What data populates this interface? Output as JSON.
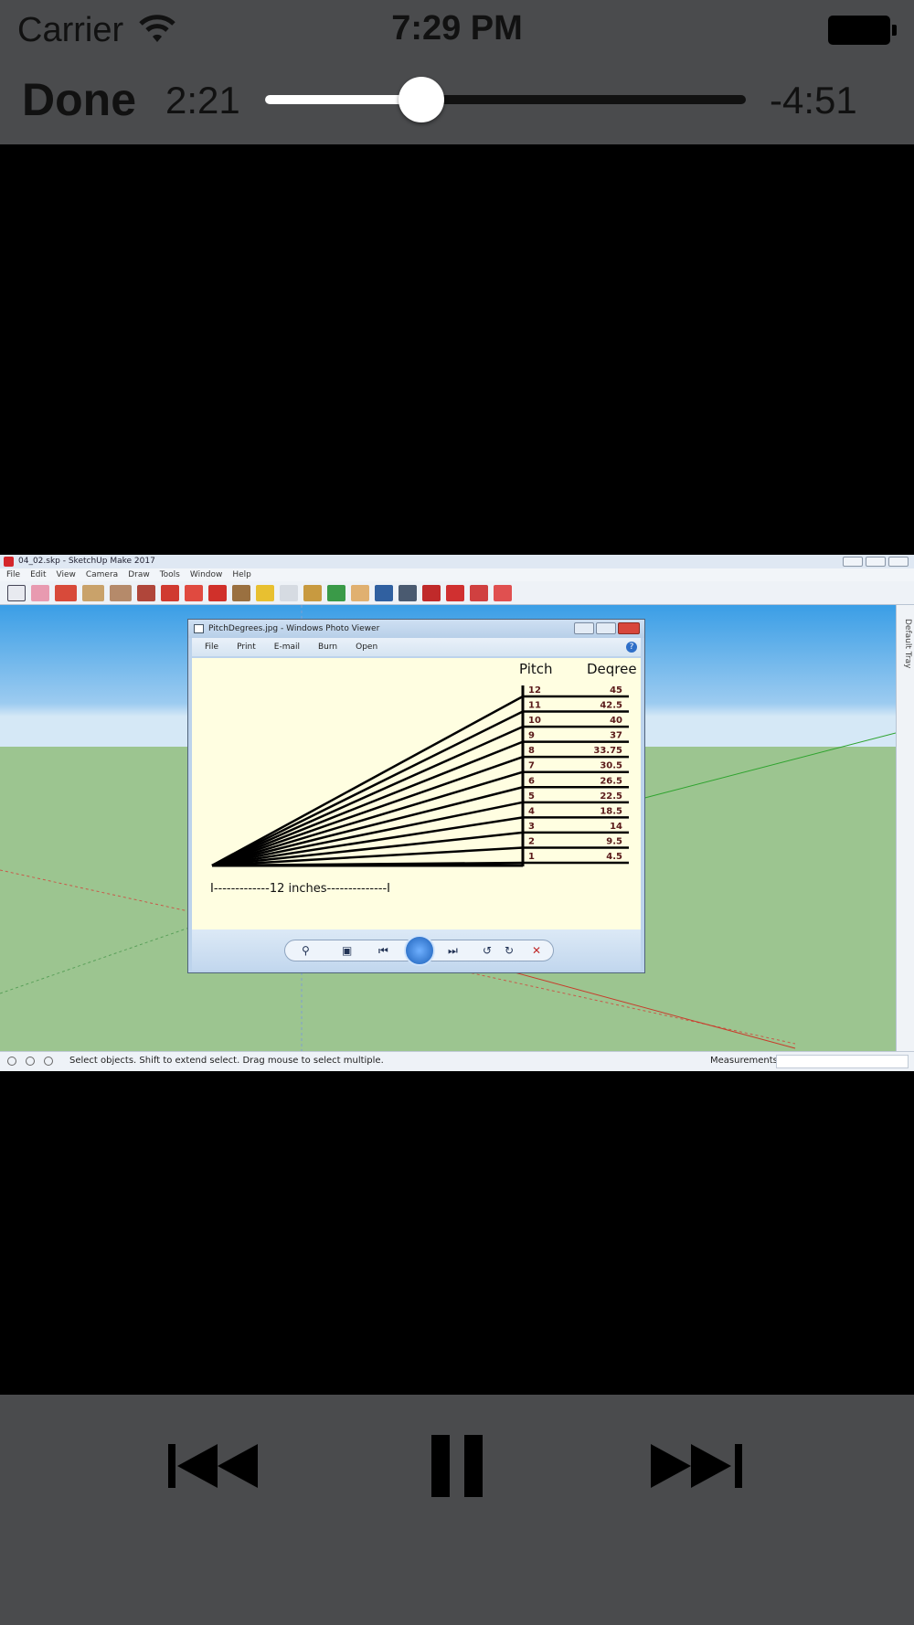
{
  "status_bar": {
    "carrier": "Carrier",
    "time": "7:29 PM",
    "wifi_icon": "wifi-icon",
    "battery_icon": "battery-icon"
  },
  "player": {
    "done_label": "Done",
    "elapsed": "2:21",
    "remaining": "-4:51",
    "progress_fraction": 0.325
  },
  "video_frame": {
    "sketchup": {
      "title": "04_02.skp - SketchUp Make 2017",
      "menu": [
        "File",
        "Edit",
        "View",
        "Camera",
        "Draw",
        "Tools",
        "Window",
        "Help"
      ],
      "tray_label": "Default Tray",
      "status_message": "Select objects. Shift to extend select. Drag mouse to select multiple.",
      "measurements_label": "Measurements"
    },
    "photo_viewer": {
      "title": "PitchDegrees.jpg - Windows Photo Viewer",
      "menu": [
        "File",
        "Print",
        "E-mail",
        "Burn",
        "Open"
      ],
      "help": "?",
      "image": {
        "pitch_header": "Pitch",
        "degree_header": "Deqree",
        "baseline_label": "I-------------12 inches--------------I",
        "rows": [
          {
            "pitch": "12",
            "degree": "45"
          },
          {
            "pitch": "11",
            "degree": "42.5"
          },
          {
            "pitch": "10",
            "degree": "40"
          },
          {
            "pitch": "9",
            "degree": "37"
          },
          {
            "pitch": "8",
            "degree": "33.75"
          },
          {
            "pitch": "7",
            "degree": "30.5"
          },
          {
            "pitch": "6",
            "degree": "26.5"
          },
          {
            "pitch": "5",
            "degree": "22.5"
          },
          {
            "pitch": "4",
            "degree": "18.5"
          },
          {
            "pitch": "3",
            "degree": "14"
          },
          {
            "pitch": "2",
            "degree": "9.5"
          },
          {
            "pitch": "1",
            "degree": "4.5"
          }
        ]
      }
    }
  },
  "transport": {
    "previous_icon": "skip-previous-icon",
    "pause_icon": "pause-icon",
    "next_icon": "skip-next-icon"
  }
}
